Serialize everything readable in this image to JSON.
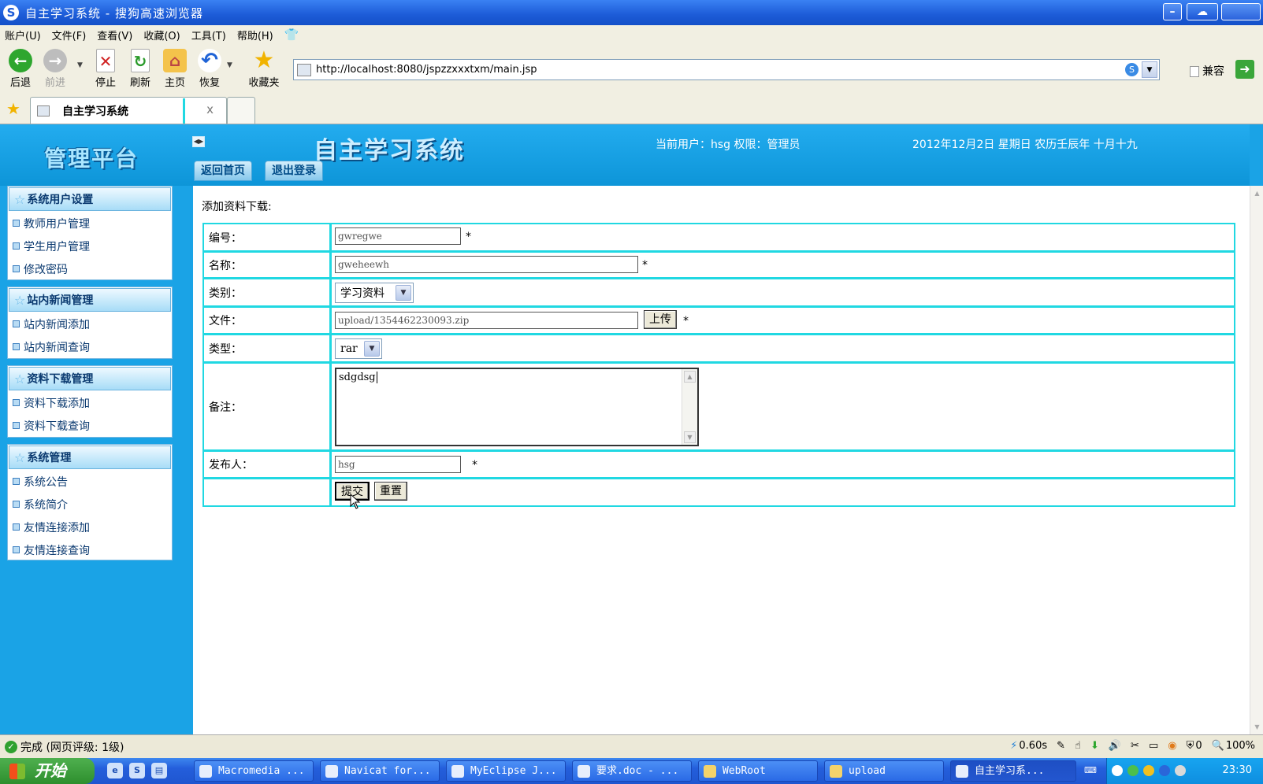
{
  "window": {
    "title": "自主学习系统 - 搜狗高速浏览器",
    "app_icon": "S"
  },
  "menu": [
    "账户(U)",
    "文件(F)",
    "查看(V)",
    "收藏(O)",
    "工具(T)",
    "帮助(H)"
  ],
  "toolbar": {
    "back": "后退",
    "forward": "前进",
    "stop": "停止",
    "refresh": "刷新",
    "home": "主页",
    "restore": "恢复",
    "favorites": "收藏夹",
    "url": "http://localhost:8080/jspzzxxxtxm/main.jsp",
    "compat": "兼容"
  },
  "tabs": {
    "active": "自主学习系统",
    "close": "x"
  },
  "header": {
    "platform": "管理平台",
    "system_title": "自主学习系统",
    "current_user": "当前用户：hsg 权限：管理员",
    "date": "2012年12月2日 星期日 农历壬辰年 十月十九",
    "home_btn": "返回首页",
    "logout_btn": "退出登录"
  },
  "sidebar": [
    {
      "title": "系统用户设置",
      "items": [
        "教师用户管理",
        "学生用户管理",
        "修改密码"
      ]
    },
    {
      "title": "站内新闻管理",
      "items": [
        "站内新闻添加",
        "站内新闻查询"
      ]
    },
    {
      "title": "资料下载管理",
      "items": [
        "资料下载添加",
        "资料下载查询"
      ]
    },
    {
      "title": "系统管理",
      "items": [
        "系统公告",
        "系统简介",
        "友情连接添加",
        "友情连接查询"
      ]
    }
  ],
  "form": {
    "title": "添加资料下载:",
    "labels": {
      "id": "编号：",
      "name": "名称：",
      "category": "类别：",
      "file": "文件：",
      "type": "类型：",
      "remark": "备注：",
      "publisher": "发布人："
    },
    "values": {
      "id": "gwregwe",
      "name": "gweheewh",
      "category": "学习资料",
      "file": "upload/1354462230093.zip",
      "type": "rar",
      "remark": "sdgdsg",
      "publisher": "hsg"
    },
    "required": "*",
    "upload_btn": "上传",
    "submit_btn": "提交",
    "reset_btn": "重置"
  },
  "statusbar": {
    "status": "完成 (网页评级: 1级)",
    "load_time": "0.60s",
    "count": "0",
    "zoom": "100%"
  },
  "taskbar": {
    "start": "开始",
    "tasks": [
      "Macromedia ...",
      "Navicat for...",
      "MyEclipse J...",
      "要求.doc - ...",
      "WebRoot",
      "upload",
      "自主学习系..."
    ],
    "clock": "23:30"
  }
}
